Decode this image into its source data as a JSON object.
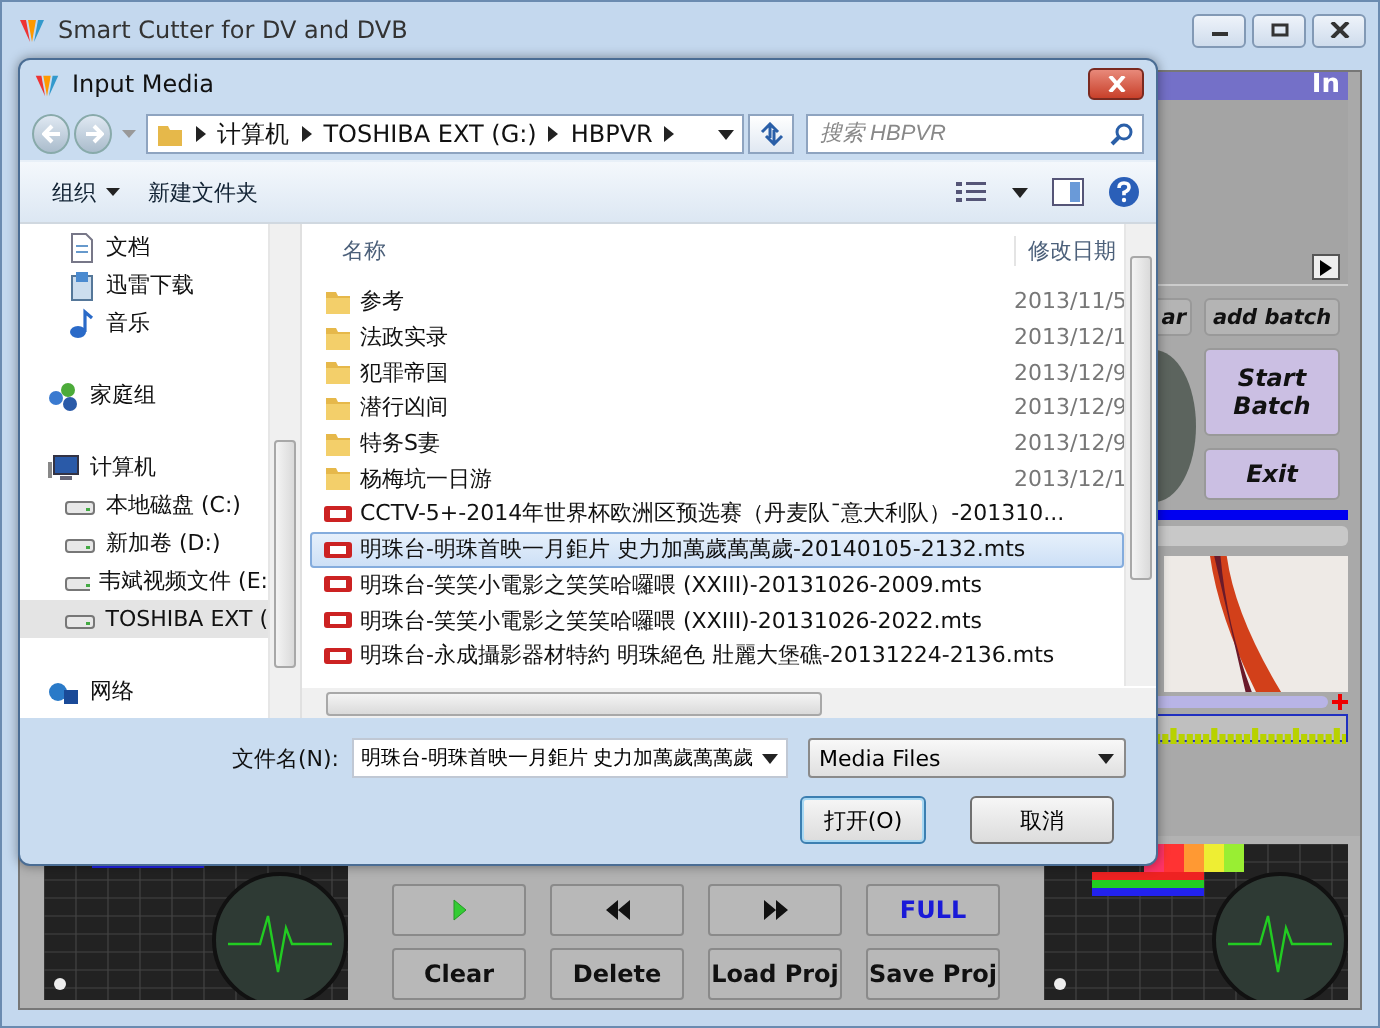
{
  "window": {
    "title": "Smart Cutter for DV and DVB"
  },
  "app": {
    "header": "In",
    "side_buttons": [
      {
        "label": "ar",
        "kind": "plain"
      },
      {
        "label": "add batch",
        "kind": "plain"
      },
      {
        "label": "Start Batch",
        "kind": "accent"
      },
      {
        "label": "Exit",
        "kind": "accent"
      }
    ],
    "controls": [
      {
        "kind": "play"
      },
      {
        "kind": "rewind"
      },
      {
        "kind": "forward"
      },
      {
        "kind": "text",
        "label": "FULL"
      },
      {
        "kind": "text",
        "label": "Clear"
      },
      {
        "kind": "text",
        "label": "Delete"
      },
      {
        "kind": "text",
        "label": "Load Proj"
      },
      {
        "kind": "text",
        "label": "Save Proj"
      }
    ]
  },
  "dialog": {
    "title": "Input Media",
    "breadcrumb": [
      "计算机",
      "TOSHIBA EXT (G:)",
      "HBPVR"
    ],
    "search": {
      "placeholder": "搜索 HBPVR"
    },
    "toolbar": [
      {
        "kind": "menu",
        "label": "组织"
      },
      {
        "kind": "button",
        "label": "新建文件夹"
      }
    ],
    "nav_pane": [
      {
        "items": [
          {
            "kind": "document",
            "label": "文档",
            "selected": false
          },
          {
            "kind": "download",
            "label": "迅雷下载",
            "selected": false
          },
          {
            "kind": "music",
            "label": "音乐",
            "selected": false
          }
        ]
      },
      {
        "items": [
          {
            "kind": "homegroup",
            "label": "家庭组",
            "selected": false
          }
        ]
      },
      {
        "items": [
          {
            "kind": "computer",
            "label": "计算机",
            "selected": false,
            "children": [
              {
                "kind": "drive",
                "label": "本地磁盘 (C:)",
                "selected": false
              },
              {
                "kind": "drive",
                "label": "新加卷 (D:)",
                "selected": false
              },
              {
                "kind": "drive",
                "label": "韦斌视频文件 (E:",
                "selected": false
              },
              {
                "kind": "drive",
                "label": "TOSHIBA EXT (",
                "selected": true
              }
            ]
          }
        ]
      },
      {
        "items": [
          {
            "kind": "network",
            "label": "网络",
            "selected": false
          }
        ]
      }
    ],
    "columns": [
      "名称",
      "修改日期"
    ],
    "files": [
      {
        "kind": "folder",
        "name": "参考",
        "date": "2013/11/5",
        "selected": false
      },
      {
        "kind": "folder",
        "name": "法政实录",
        "date": "2013/12/1",
        "selected": false
      },
      {
        "kind": "folder",
        "name": "犯罪帝国",
        "date": "2013/12/9",
        "selected": false
      },
      {
        "kind": "folder",
        "name": "潜行凶间",
        "date": "2013/12/9",
        "selected": false
      },
      {
        "kind": "folder",
        "name": "特务S妻",
        "date": "2013/12/9",
        "selected": false
      },
      {
        "kind": "folder",
        "name": "杨梅坑一日游",
        "date": "2013/12/1",
        "selected": false
      },
      {
        "kind": "video",
        "name": "CCTV-5+-2014年世界杯欧洲区预选赛（丹麦队¯意大利队）-201310...",
        "selected": false
      },
      {
        "kind": "video",
        "name": "明珠台-明珠首映一月鉅片 史力加萬歲萬萬歲-20140105-2132.mts",
        "selected": true
      },
      {
        "kind": "video",
        "name": "明珠台-笑笑小電影之笑笑哈囉喂 (XXIII)-20131026-2009.mts",
        "selected": false
      },
      {
        "kind": "video",
        "name": "明珠台-笑笑小電影之笑笑哈囉喂 (XXIII)-20131026-2022.mts",
        "selected": false
      },
      {
        "kind": "video",
        "name": "明珠台-永成攝影器材特約 明珠絕色 壯麗大堡礁-20131224-2136.mts",
        "selected": false
      }
    ],
    "file_name": {
      "label": "文件名(N):",
      "value": "明珠台-明珠首映一月鉅片 史力加萬歲萬萬歲"
    },
    "file_type": "Media Files",
    "buttons": [
      {
        "label": "打开(O)",
        "default": true
      },
      {
        "label": "取消",
        "default": false
      }
    ]
  }
}
